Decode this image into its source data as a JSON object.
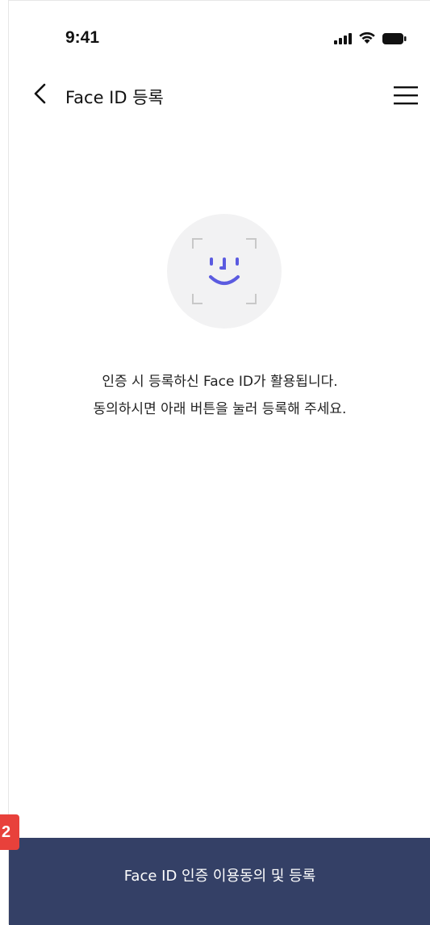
{
  "status_bar": {
    "time": "9:41",
    "icons": [
      "signal-icon",
      "wifi-icon",
      "battery-icon"
    ]
  },
  "header": {
    "title": "Face ID 등록",
    "back_icon": "chevron-left-icon",
    "menu_icon": "hamburger-menu-icon"
  },
  "illustration": {
    "icon": "face-id-icon",
    "accent_color": "#5b5be0",
    "frame_color": "#c8c8c8"
  },
  "description": {
    "line1": "인증 시 등록하신 Face ID가 활용됩니다.",
    "line2": "동의하시면 아래 버튼을 눌러 등록해 주세요."
  },
  "footer": {
    "button_label": "Face ID 인증 이용동의 및 등록",
    "button_color": "#344066"
  },
  "marker": {
    "label": "2",
    "color": "#e8413b"
  }
}
